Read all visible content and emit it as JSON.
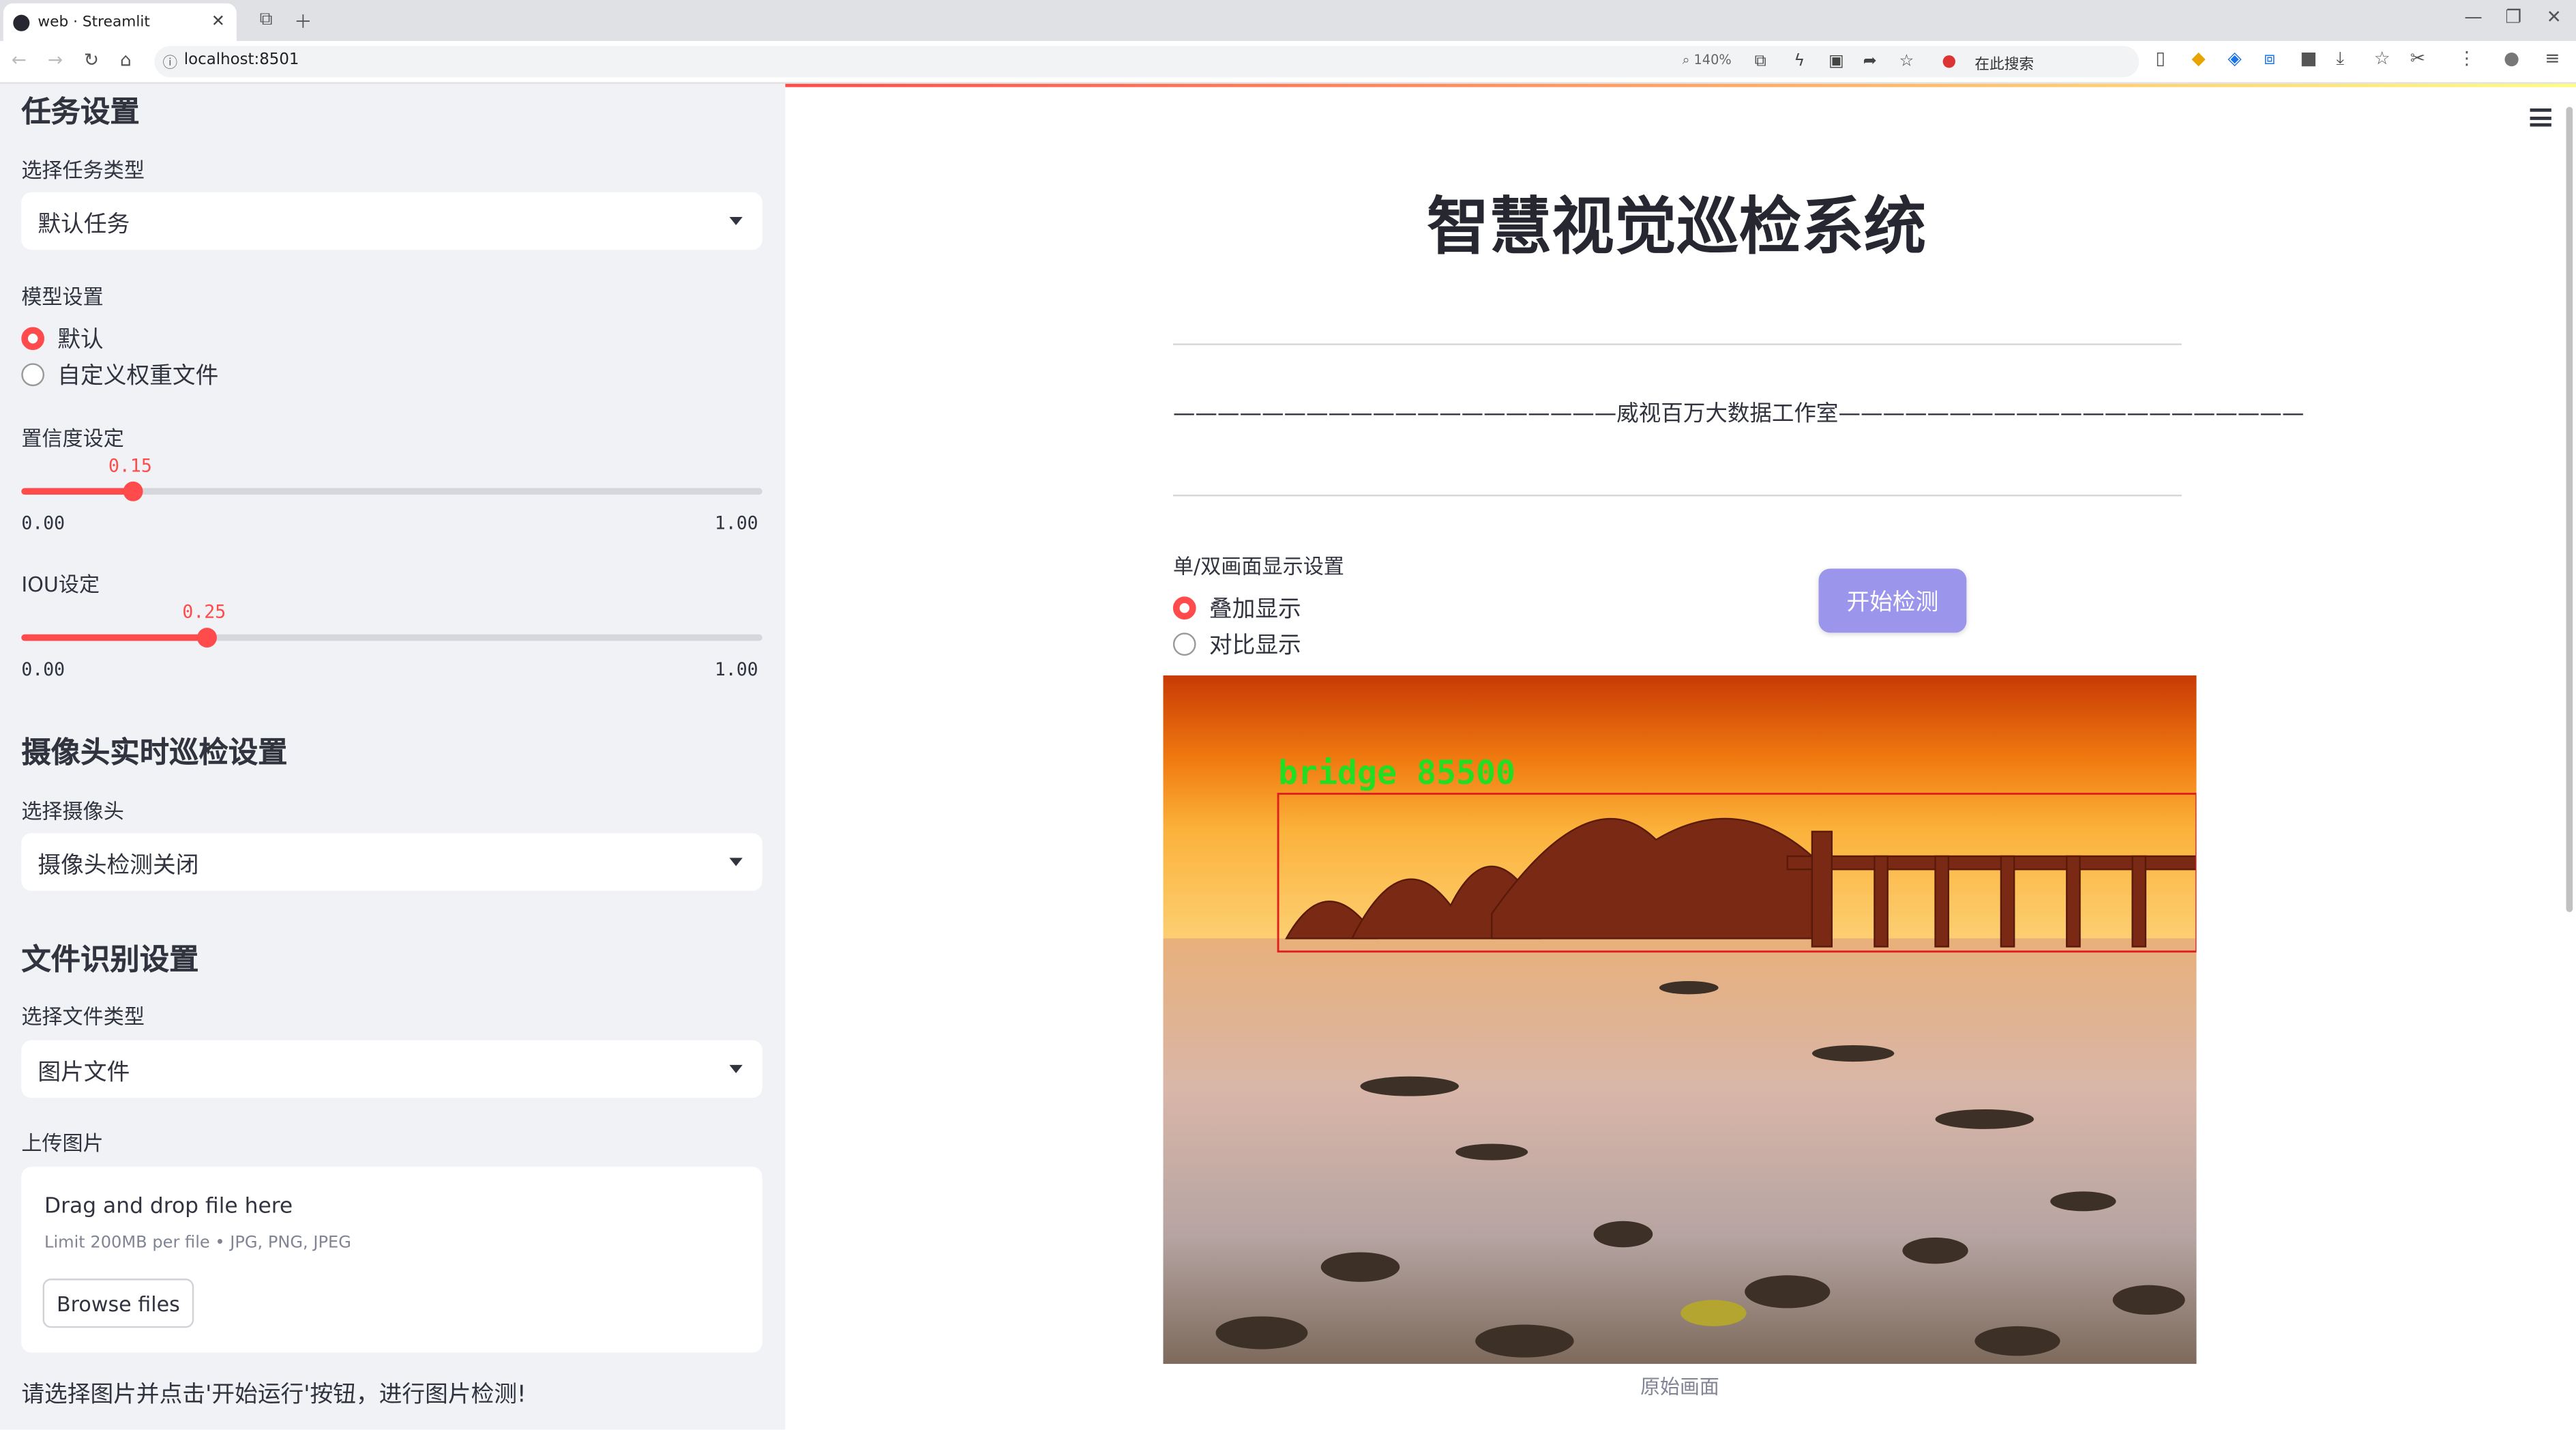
{
  "browser": {
    "tab_title": "web · Streamlit",
    "url": "localhost:8501",
    "zoom": "140%",
    "search_placeholder": "在此搜索"
  },
  "sidebar": {
    "task_header": "任务设置",
    "task_type_label": "选择任务类型",
    "task_type_value": "默认任务",
    "model_label": "模型设置",
    "model_options": [
      "默认",
      "自定义权重文件"
    ],
    "model_selected": 0,
    "conf_label": "置信度设定",
    "conf_value": "0.15",
    "conf_min": "0.00",
    "conf_max": "1.00",
    "iou_label": "IOU设定",
    "iou_value": "0.25",
    "iou_min": "0.00",
    "iou_max": "1.00",
    "camera_header": "摄像头实时巡检设置",
    "camera_label": "选择摄像头",
    "camera_value": "摄像头检测关闭",
    "file_header": "文件识别设置",
    "file_type_label": "选择文件类型",
    "file_type_value": "图片文件",
    "upload_label": "上传图片",
    "drop_title": "Drag and drop file here",
    "drop_limit": "Limit 200MB per file • JPG, PNG, JPEG",
    "browse_label": "Browse files",
    "hint": "请选择图片并点击'开始运行'按钮，进行图片检测!"
  },
  "main": {
    "title": "智慧视觉巡检系统",
    "subtitle": "————————————————————威视百万大数据工作室—————————————————————",
    "display_label": "单/双画面显示设置",
    "display_options": [
      "叠加显示",
      "对比显示"
    ],
    "display_selected": 0,
    "start_button": "开始检测",
    "detection_label": "bridge  85500",
    "image_caption": "原始画面"
  },
  "colors": {
    "accent": "#ff4b4b",
    "button": "#9c95ec",
    "detection_box": "#e02020",
    "detection_text": "#22dd22",
    "sidebar_bg": "#f0f2f6"
  }
}
